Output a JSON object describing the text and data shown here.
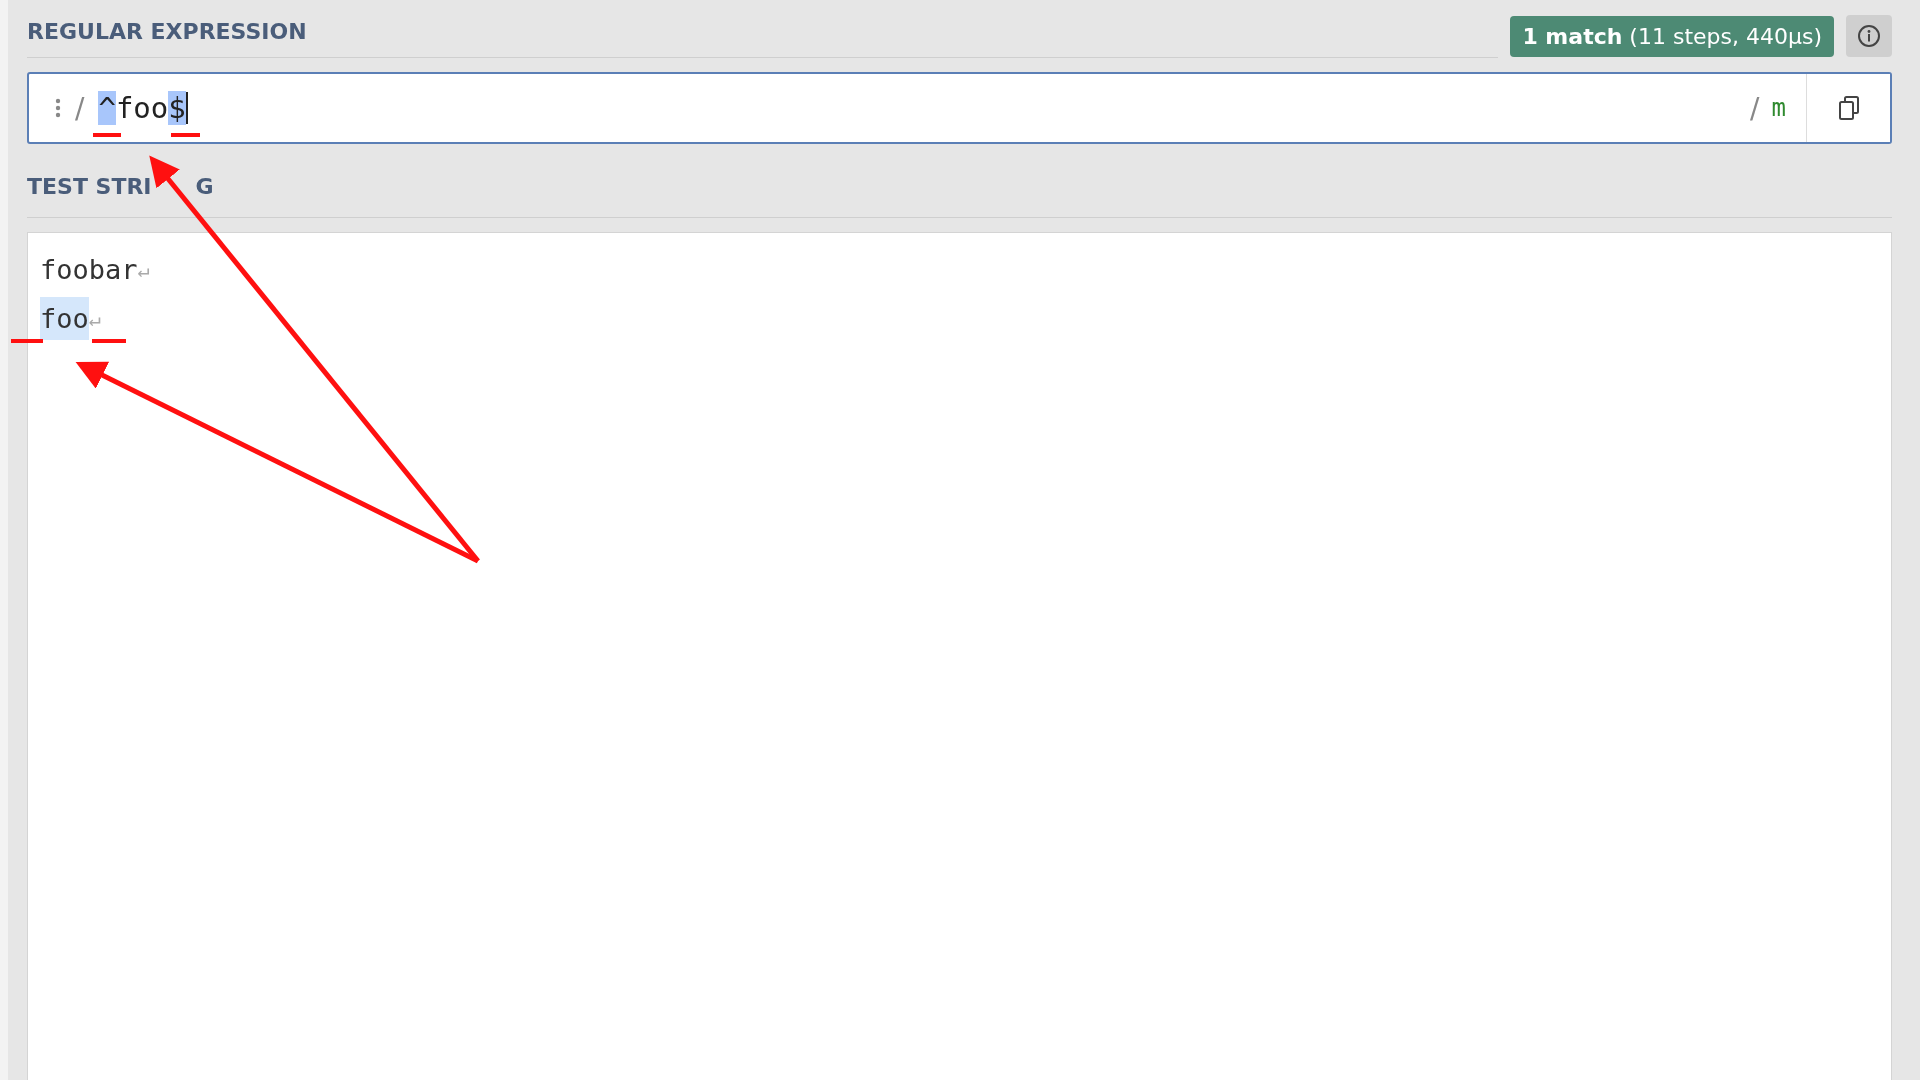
{
  "regex_section": {
    "label": "REGULAR EXPRESSION",
    "match_info": "**1 match** (11 steps, 440µs)",
    "field": {
      "open_delimiter": "/",
      "tokens": [
        {
          "text": "^",
          "highlighted": true
        },
        {
          "text": "foo",
          "highlighted": false
        },
        {
          "text": "$",
          "highlighted": true
        }
      ],
      "close_delimiter": "/",
      "flags": "m"
    }
  },
  "test_section": {
    "label_parts": [
      "TEST STRI",
      "G"
    ],
    "lines": [
      {
        "segments": [
          {
            "text": "foobar",
            "match": false
          }
        ],
        "eol": "↵"
      },
      {
        "segments": [
          {
            "text": "foo",
            "match": true
          }
        ],
        "eol": "↵"
      }
    ]
  }
}
